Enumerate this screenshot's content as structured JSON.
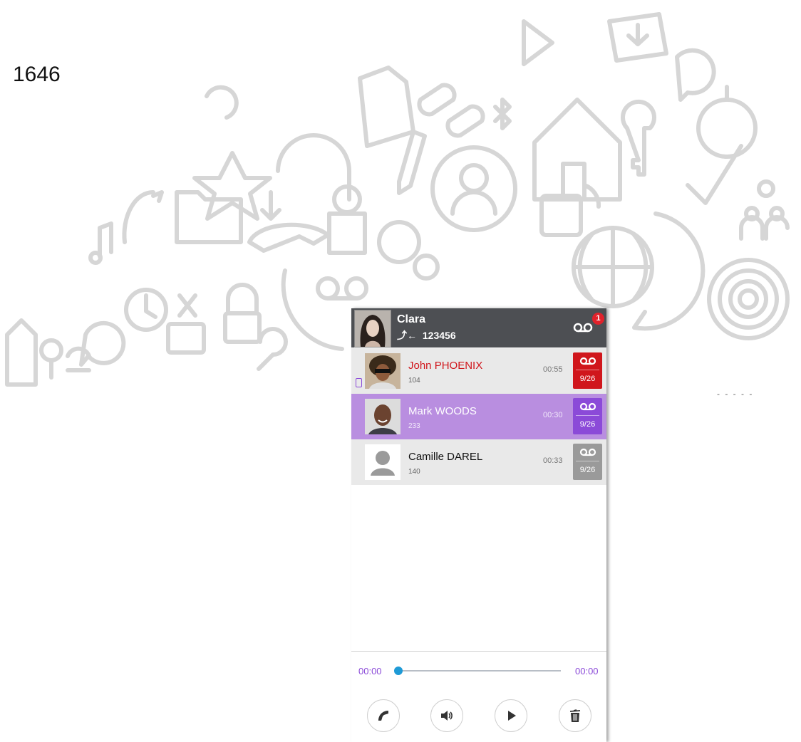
{
  "page_number": "1646",
  "decor_dashes": "- - - - -",
  "header": {
    "name": "Clara",
    "number": "123456",
    "voicemail_badge": "1"
  },
  "contacts": [
    {
      "name": "John PHOENIX",
      "ext": "104",
      "time": "00:55",
      "count": "9/26",
      "state": "unread-red",
      "device": "mobile"
    },
    {
      "name": "Mark WOODS",
      "ext": "233",
      "time": "00:30",
      "count": "9/26",
      "state": "selected"
    },
    {
      "name": "Camille DAREL",
      "ext": "140",
      "time": "00:33",
      "count": "9/26",
      "state": "read"
    }
  ],
  "player": {
    "elapsed": "00:00",
    "duration": "00:00",
    "progress": 0
  },
  "controls": [
    "call-back-icon",
    "speaker-icon",
    "play-icon",
    "trash-icon"
  ],
  "colors": {
    "header_bg": "#4d4f53",
    "selected_row": "#b98ee0",
    "accent_purple": "#8b4ad8",
    "unread_red": "#d0161c",
    "read_gray": "#9a9a9a",
    "knob_blue": "#1e9ad6"
  }
}
